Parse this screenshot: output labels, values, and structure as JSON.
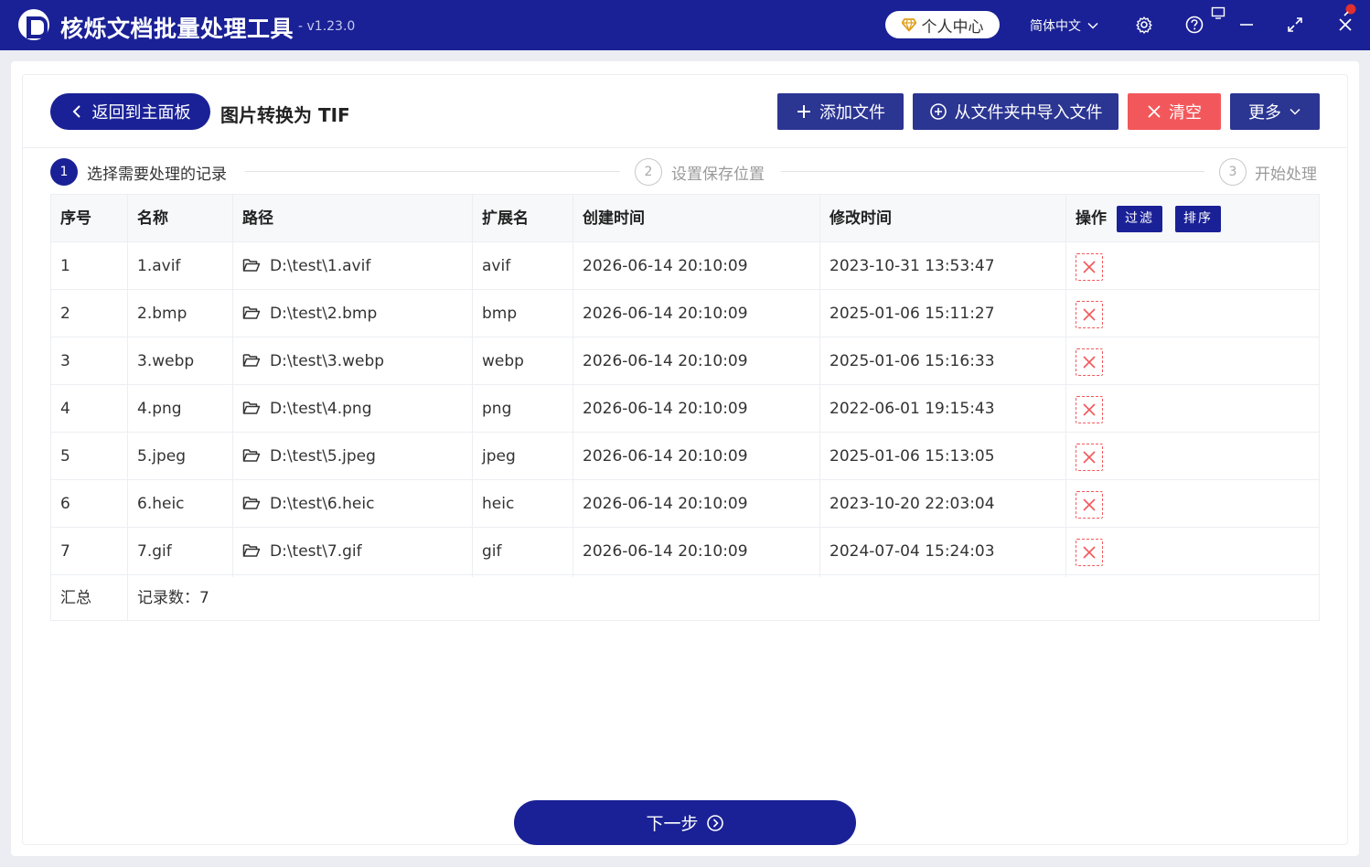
{
  "app": {
    "title": "核烁文档批量处理工具",
    "version": "- v1.23.0",
    "user_center": "个人中心",
    "language": "简体中文"
  },
  "header": {
    "back_label": "返回到主面板",
    "page_title": "图片转换为 TIF",
    "add_file": "添加文件",
    "import_folder": "从文件夹中导入文件",
    "clear": "清空",
    "more": "更多"
  },
  "steps": [
    {
      "number": "1",
      "label": "选择需要处理的记录"
    },
    {
      "number": "2",
      "label": "设置保存位置"
    },
    {
      "number": "3",
      "label": "开始处理"
    }
  ],
  "table": {
    "columns": [
      "序号",
      "名称",
      "路径",
      "扩展名",
      "创建时间",
      "修改时间",
      "操作"
    ],
    "filter_label": "过滤",
    "sort_label": "排序",
    "rows": [
      {
        "index": "1",
        "name": "1.avif",
        "path": "D:\\test\\1.avif",
        "ext": "avif",
        "created": "2026-06-14 20:10:09",
        "modified": "2023-10-31 13:53:47"
      },
      {
        "index": "2",
        "name": "2.bmp",
        "path": "D:\\test\\2.bmp",
        "ext": "bmp",
        "created": "2026-06-14 20:10:09",
        "modified": "2025-01-06 15:11:27"
      },
      {
        "index": "3",
        "name": "3.webp",
        "path": "D:\\test\\3.webp",
        "ext": "webp",
        "created": "2026-06-14 20:10:09",
        "modified": "2025-01-06 15:16:33"
      },
      {
        "index": "4",
        "name": "4.png",
        "path": "D:\\test\\4.png",
        "ext": "png",
        "created": "2026-06-14 20:10:09",
        "modified": "2022-06-01 19:15:43"
      },
      {
        "index": "5",
        "name": "5.jpeg",
        "path": "D:\\test\\5.jpeg",
        "ext": "jpeg",
        "created": "2026-06-14 20:10:09",
        "modified": "2025-01-06 15:13:05"
      },
      {
        "index": "6",
        "name": "6.heic",
        "path": "D:\\test\\6.heic",
        "ext": "heic",
        "created": "2026-06-14 20:10:09",
        "modified": "2023-10-20 22:03:04"
      },
      {
        "index": "7",
        "name": "7.gif",
        "path": "D:\\test\\7.gif",
        "ext": "gif",
        "created": "2026-06-14 20:10:09",
        "modified": "2024-07-04 15:24:03"
      }
    ],
    "summary_label": "汇总",
    "summary_value": "记录数：7"
  },
  "footer": {
    "next_label": "下一步"
  },
  "colors": {
    "primary": "#1a2196",
    "danger": "#f2585b",
    "button_blue": "#2b3592"
  }
}
